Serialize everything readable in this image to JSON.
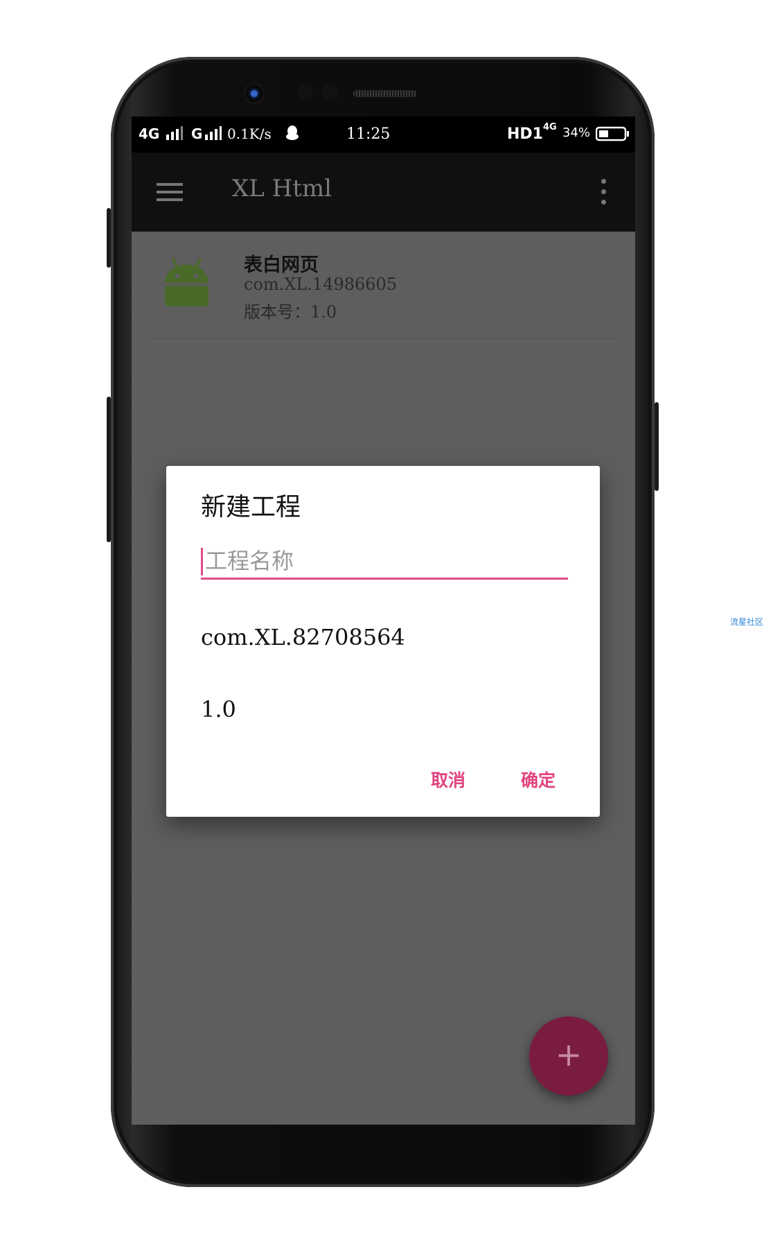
{
  "statusbar": {
    "network_left": "4G",
    "network_mid": "G",
    "speed": "0.1K/s",
    "time": "11:25",
    "hd": "HD1",
    "net_4g": "4G",
    "battery": "34%"
  },
  "toolbar": {
    "title": "XL Html"
  },
  "project_list": [
    {
      "name": "表白网页",
      "package": "com.XL.14986605",
      "version": "版本号：1.0"
    }
  ],
  "dialog": {
    "title": "新建工程",
    "name_placeholder": "工程名称",
    "name_value": "",
    "package": "com.XL.82708564",
    "version": "1.0",
    "cancel_label": "取消",
    "confirm_label": "确定"
  },
  "fab": {
    "icon": "plus-icon",
    "glyph": "+"
  },
  "watermark": "流星社区",
  "colors": {
    "accent": "#e0437f",
    "fab": "#7a1c40",
    "android_green": "#4a6a2a"
  }
}
